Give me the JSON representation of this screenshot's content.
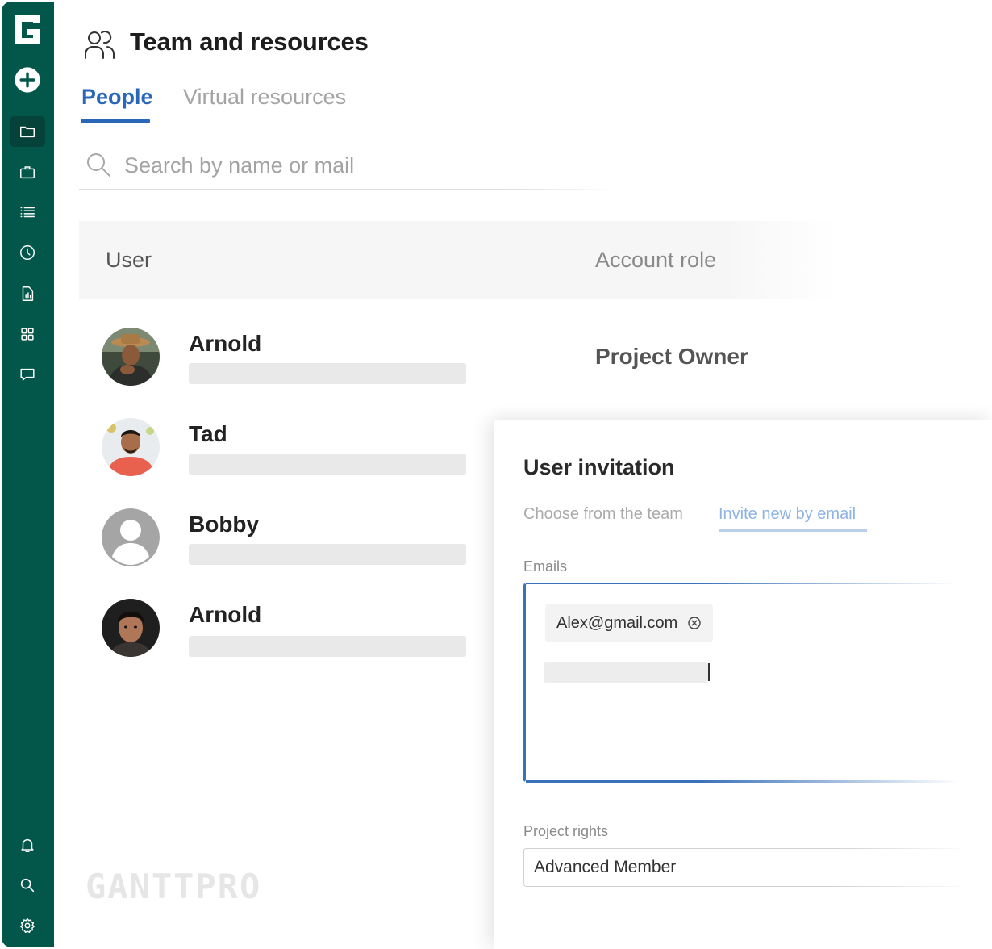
{
  "header": {
    "title": "Team and resources"
  },
  "tabs": [
    {
      "label": "People",
      "active": true
    },
    {
      "label": "Virtual resources",
      "active": false
    }
  ],
  "search": {
    "placeholder": "Search by name or mail"
  },
  "table": {
    "columns": [
      "User",
      "Account role"
    ],
    "rows": [
      {
        "name": "Arnold",
        "role": "Project Owner"
      },
      {
        "name": "Tad",
        "role": ""
      },
      {
        "name": "Bobby",
        "role": ""
      },
      {
        "name": "Arnold",
        "role": ""
      }
    ]
  },
  "watermark": "GANTTPRO",
  "invitation": {
    "title": "User invitation",
    "tabs": [
      {
        "label": "Choose from the team",
        "active": false
      },
      {
        "label": "Invite new by email",
        "active": true
      }
    ],
    "emails_label": "Emails",
    "email_chips": [
      "Alex@gmail.com"
    ],
    "project_rights_label": "Project rights",
    "project_rights_value": "Advanced Member"
  },
  "sidebar": {
    "icons": [
      "logo",
      "add-icon",
      "folder-icon",
      "briefcase-icon",
      "list-icon",
      "clock-icon",
      "report-icon",
      "apps-icon",
      "chat-icon",
      "bell-icon",
      "search-icon",
      "gear-icon"
    ]
  },
  "colors": {
    "sidebar": "#02574a",
    "accent": "#2a67b8"
  }
}
